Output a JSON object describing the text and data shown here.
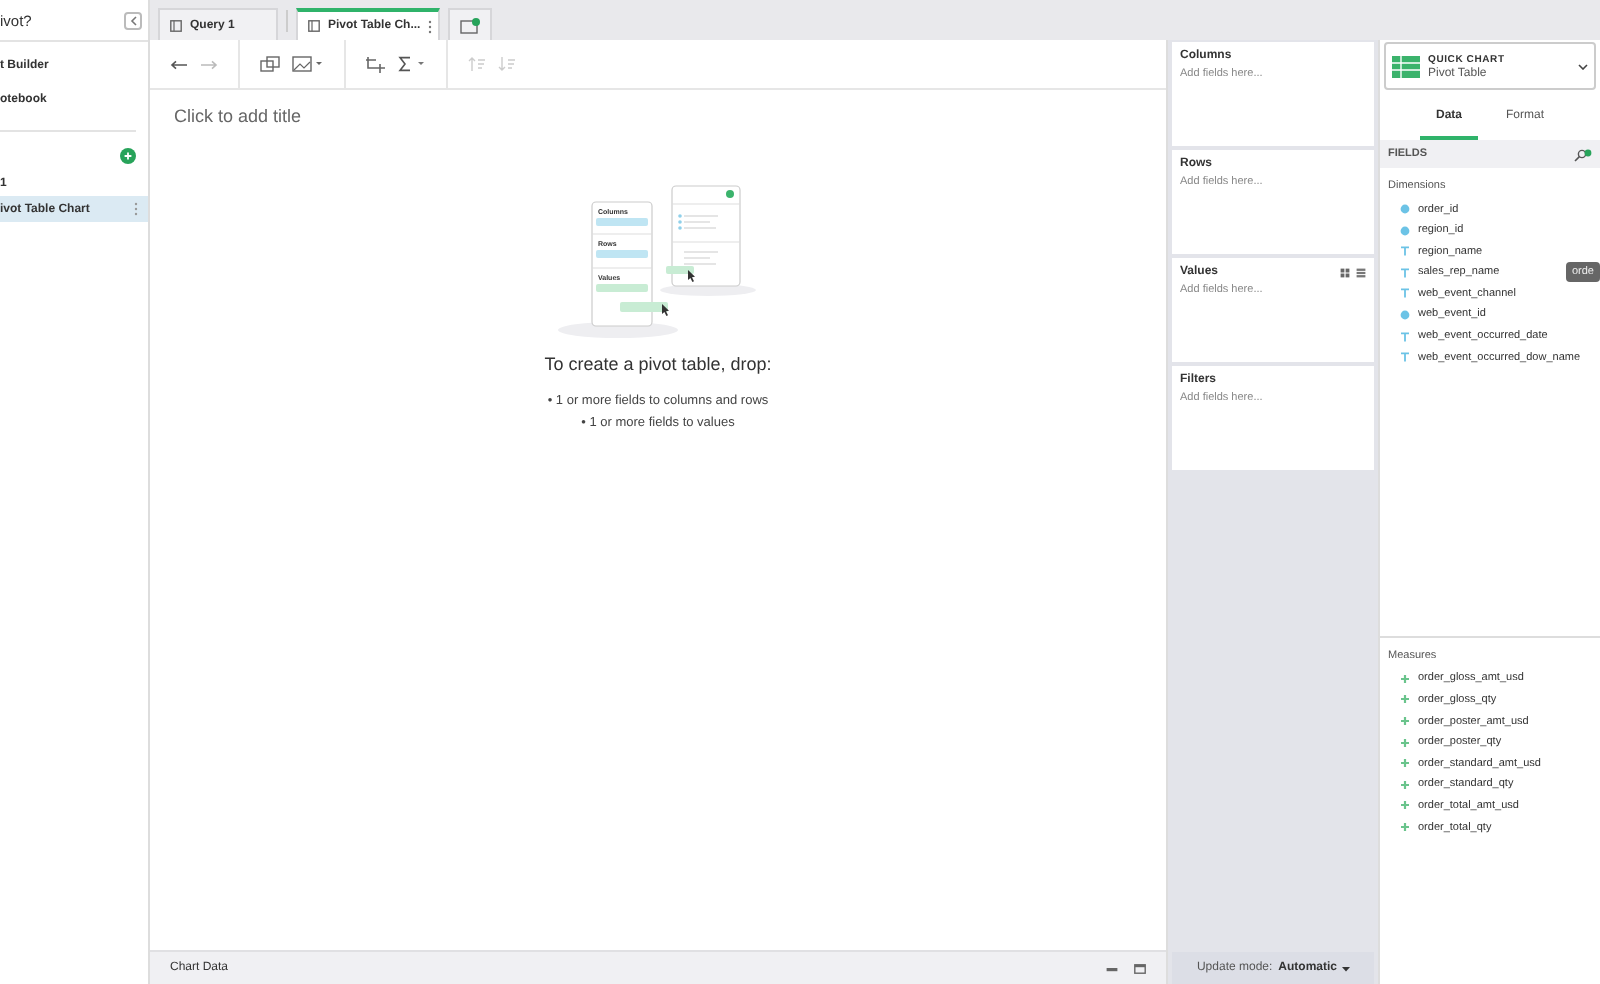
{
  "sidebar": {
    "title": "ivot?",
    "items": [
      {
        "label": "t Builder",
        "selected": false
      },
      {
        "label": "otebook",
        "selected": false
      }
    ],
    "section_label": "1",
    "charts": [
      {
        "label": "ivot Table Chart",
        "selected": true
      }
    ]
  },
  "tabs": [
    {
      "label": "Query 1",
      "selected": false
    },
    {
      "label": "Pivot Table Ch...",
      "selected": true
    }
  ],
  "canvas": {
    "title_placeholder": "Click to add title",
    "illustration": {
      "labels": [
        "Columns",
        "Rows",
        "Values"
      ]
    },
    "heading": "To create a pivot table, drop:",
    "bullets": [
      "• 1 or more fields to columns and rows",
      "• 1 or more fields to values"
    ]
  },
  "shelves": [
    {
      "label": "Columns",
      "placeholder": "Add fields here...",
      "kind": "plain"
    },
    {
      "label": "Rows",
      "placeholder": "Add fields here...",
      "kind": "plain"
    },
    {
      "label": "Values",
      "placeholder": "Add fields here...",
      "kind": "values"
    },
    {
      "label": "Filters",
      "placeholder": "Add fields here...",
      "kind": "plain"
    }
  ],
  "chart_type": {
    "label": "QUICK CHART",
    "value": "Pivot Table"
  },
  "panel_tabs": [
    {
      "label": "Data",
      "selected": true
    },
    {
      "label": "Format",
      "selected": false
    }
  ],
  "fields_label": "FIELDS",
  "dimensions": {
    "label": "Dimensions",
    "items": [
      {
        "name": "order_id",
        "kind": "number"
      },
      {
        "name": "region_id",
        "kind": "number"
      },
      {
        "name": "region_name",
        "kind": "text"
      },
      {
        "name": "sales_rep_name",
        "kind": "text"
      },
      {
        "name": "web_event_channel",
        "kind": "text"
      },
      {
        "name": "web_event_id",
        "kind": "number"
      },
      {
        "name": "web_event_occurred_date",
        "kind": "text"
      },
      {
        "name": "web_event_occurred_dow_name",
        "kind": "text"
      }
    ]
  },
  "tooltip": "orde",
  "measures": {
    "label": "Measures",
    "items": [
      {
        "name": "order_gloss_amt_usd",
        "kind": "measure"
      },
      {
        "name": "order_gloss_qty",
        "kind": "measure"
      },
      {
        "name": "order_poster_amt_usd",
        "kind": "measure"
      },
      {
        "name": "order_poster_qty",
        "kind": "measure"
      },
      {
        "name": "order_standard_amt_usd",
        "kind": "measure"
      },
      {
        "name": "order_standard_qty",
        "kind": "measure"
      },
      {
        "name": "order_total_amt_usd",
        "kind": "measure"
      },
      {
        "name": "order_total_qty",
        "kind": "measure"
      }
    ]
  },
  "bottom_bar": {
    "label": "Chart Data"
  },
  "update_mode": {
    "label": "Update mode:",
    "value": "Automatic"
  }
}
